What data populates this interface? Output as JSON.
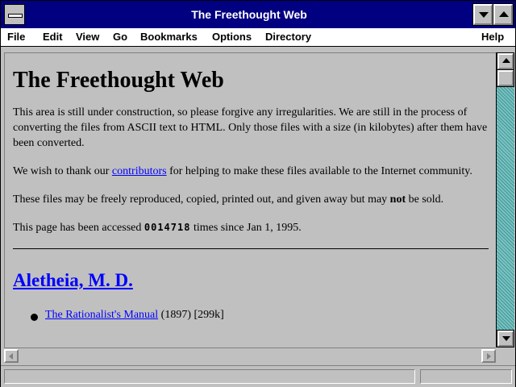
{
  "window": {
    "title": "The Freethought Web"
  },
  "menu": {
    "items": [
      {
        "label": "File"
      },
      {
        "label": "Edit"
      },
      {
        "label": "View"
      },
      {
        "label": "Go"
      },
      {
        "label": "Bookmarks"
      },
      {
        "label": "Options"
      },
      {
        "label": "Directory"
      },
      {
        "label": "Help"
      }
    ]
  },
  "page": {
    "heading": "The Freethought Web",
    "intro": "This area is still under construction, so please forgive any irregularities. We are still in the process of converting the files from ASCII text to HTML. Only those files with a size (in kilobytes) after them have been converted.",
    "thanks_before": "We wish to thank our ",
    "thanks_link": "contributors",
    "thanks_after": " for helping to make these files available to the Internet community.",
    "rights_before": "These files may be freely reproduced, copied, printed out, and given away but may ",
    "rights_bold": "not",
    "rights_after": " be sold.",
    "access_before": "This page has been accessed ",
    "access_count": "0014718",
    "access_after": " times since Jan 1, 1995.",
    "section_title": "Aletheia, M. D.",
    "list": [
      {
        "title": "The Rationalist's Manual",
        "meta": " (1897) [299k]"
      }
    ]
  },
  "status": {
    "text": ""
  },
  "colors": {
    "titlebar": "#000080",
    "link": "#0000ff",
    "background": "#c0c0c0"
  }
}
